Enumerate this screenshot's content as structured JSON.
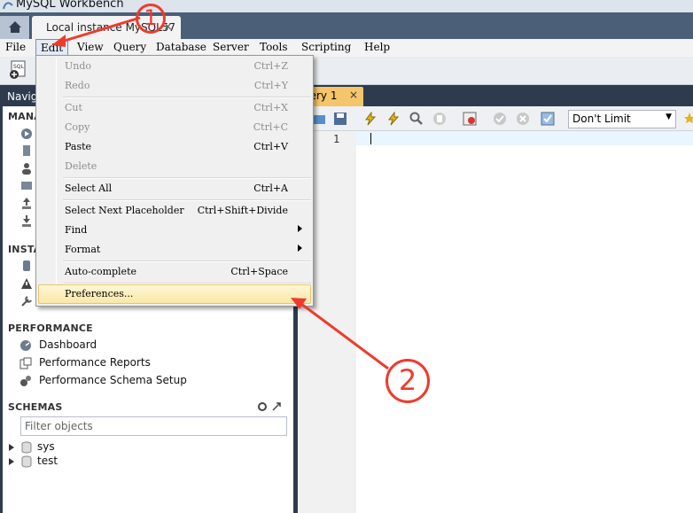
{
  "window": {
    "title": "MySQL Workbench"
  },
  "tabs": {
    "connection_tab": "Local instance MySQL57",
    "close_glyph": "×"
  },
  "menubar": [
    "File",
    "Edit",
    "View",
    "Query",
    "Database",
    "Server",
    "Tools",
    "Scripting",
    "Help"
  ],
  "navigator": {
    "header": "Navig",
    "management_title": "MANA",
    "instance_title": "INSTA",
    "performance_title": "PERFORMANCE",
    "performance_items": [
      "Dashboard",
      "Performance Reports",
      "Performance Schema Setup"
    ],
    "schemas_title": "SCHEMAS",
    "filter_placeholder": "Filter objects",
    "schemas": [
      "sys",
      "test"
    ]
  },
  "query_tab": {
    "label": "uery 1",
    "close": "×"
  },
  "editor": {
    "limit_value": "Don't Limit",
    "line_number": "1"
  },
  "edit_menu": {
    "items": [
      {
        "label": "Undo",
        "shortcut": "Ctrl+Z",
        "enabled": false
      },
      {
        "label": "Redo",
        "shortcut": "Ctrl+Y",
        "enabled": false
      },
      {
        "label": "Cut",
        "shortcut": "Ctrl+X",
        "enabled": false
      },
      {
        "label": "Copy",
        "shortcut": "Ctrl+C",
        "enabled": false
      },
      {
        "label": "Paste",
        "shortcut": "Ctrl+V",
        "enabled": true
      },
      {
        "label": "Delete",
        "shortcut": "",
        "enabled": false
      },
      {
        "label": "Select All",
        "shortcut": "Ctrl+A",
        "enabled": true
      },
      {
        "label": "Select Next Placeholder",
        "shortcut": "Ctrl+Shift+Divide",
        "enabled": true
      },
      {
        "label": "Find",
        "shortcut": "",
        "enabled": true,
        "submenu": true
      },
      {
        "label": "Format",
        "shortcut": "",
        "enabled": true,
        "submenu": true
      },
      {
        "label": "Auto-complete",
        "shortcut": "Ctrl+Space",
        "enabled": true
      },
      {
        "label": "Preferences...",
        "shortcut": "",
        "enabled": true,
        "highlighted": true
      }
    ]
  },
  "annotations": {
    "step1": "1",
    "step2": "2",
    "color": "#ee3b2f"
  },
  "colors": {
    "nav_bg": "#2e3b4e",
    "tab_strip": "#4c5f79",
    "query_tab": "#f4c56a",
    "menu_highlight": "#fbe8a6"
  },
  "icons": [
    "home-icon",
    "new-sql-tab-icon",
    "open-file-icon",
    "save-icon",
    "execute-icon",
    "execute-current-icon",
    "explain-icon",
    "stop-icon",
    "toggle-output-icon",
    "commit-icon",
    "rollback-icon",
    "autocommit-icon",
    "bookmark-star-icon",
    "refresh-icon",
    "expand-icon",
    "database-icon"
  ]
}
